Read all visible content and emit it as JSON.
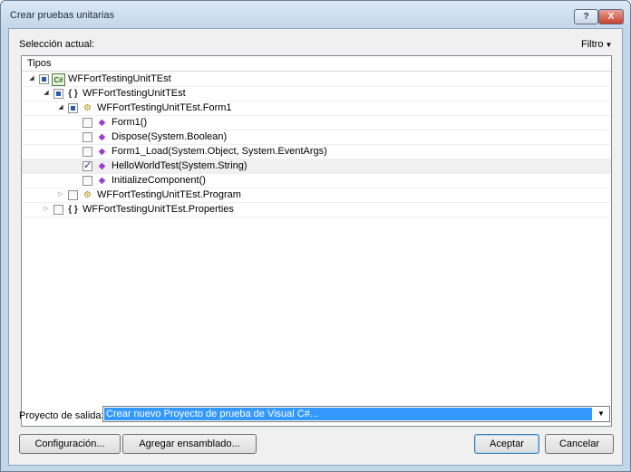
{
  "window": {
    "title": "Crear pruebas unitarias",
    "help_label": "?",
    "close_label": "X"
  },
  "selection": {
    "label": "Selección actual:",
    "filter_label": "Filtro"
  },
  "tree": {
    "header": "Tipos",
    "nodes": [
      {
        "label": "WFFortTestingUnitTEst",
        "icon": "project-icon",
        "check": "partial",
        "expander": "expanded",
        "level": 0
      },
      {
        "label": "WFFortTestingUnitTEst",
        "icon": "namespace-icon",
        "check": "partial",
        "expander": "expanded",
        "level": 1
      },
      {
        "label": "WFFortTestingUnitTEst.Form1",
        "icon": "class-icon",
        "check": "partial",
        "expander": "expanded",
        "level": 2
      },
      {
        "label": "Form1()",
        "icon": "method-icon",
        "check": "unchecked",
        "expander": "none",
        "level": 3
      },
      {
        "label": "Dispose(System.Boolean)",
        "icon": "method-icon",
        "check": "unchecked",
        "expander": "none",
        "level": 3
      },
      {
        "label": "Form1_Load(System.Object, System.EventArgs)",
        "icon": "method-icon",
        "check": "unchecked",
        "expander": "none",
        "level": 3
      },
      {
        "label": "HelloWorldTest(System.String)",
        "icon": "method-icon",
        "check": "checked",
        "expander": "none",
        "level": 3
      },
      {
        "label": "InitializeComponent()",
        "icon": "method-icon",
        "check": "unchecked",
        "expander": "none",
        "level": 3
      },
      {
        "label": "WFFortTestingUnitTEst.Program",
        "icon": "class-icon",
        "check": "unchecked",
        "expander": "collapsed",
        "level": 2
      },
      {
        "label": "WFFortTestingUnitTEst.Properties",
        "icon": "namespace-icon",
        "check": "unchecked",
        "expander": "collapsed",
        "level": 1
      }
    ]
  },
  "output": {
    "label": "Proyecto de salida:",
    "value": "Crear nuevo Proyecto de prueba de Visual C#..."
  },
  "buttons": {
    "configuration": "Configuración...",
    "add_assembly": "Agregar ensamblado...",
    "accept": "Aceptar",
    "cancel": "Cancelar"
  }
}
